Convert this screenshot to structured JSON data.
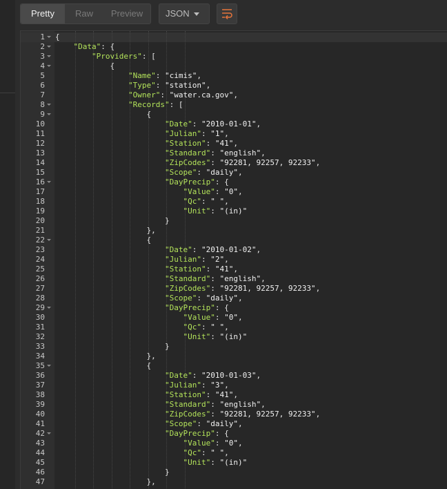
{
  "toolbar": {
    "view_modes": [
      "Pretty",
      "Raw",
      "Preview"
    ],
    "active_mode": "Pretty",
    "format_select": "JSON"
  },
  "editor": {
    "lines": [
      {
        "n": "1",
        "fold": true,
        "indent": 0,
        "parts": [
          [
            "p",
            "{"
          ]
        ]
      },
      {
        "n": "2",
        "fold": true,
        "indent": 1,
        "parts": [
          [
            "k",
            "\"Data\""
          ],
          [
            "p",
            ": {"
          ]
        ]
      },
      {
        "n": "3",
        "fold": true,
        "indent": 2,
        "parts": [
          [
            "k",
            "\"Providers\""
          ],
          [
            "p",
            ": ["
          ]
        ]
      },
      {
        "n": "4",
        "fold": true,
        "indent": 3,
        "parts": [
          [
            "p",
            "{"
          ]
        ]
      },
      {
        "n": "5",
        "fold": false,
        "indent": 4,
        "parts": [
          [
            "k",
            "\"Name\""
          ],
          [
            "p",
            ": "
          ],
          [
            "s",
            "\"cimis\""
          ],
          [
            "p",
            ","
          ]
        ]
      },
      {
        "n": "6",
        "fold": false,
        "indent": 4,
        "parts": [
          [
            "k",
            "\"Type\""
          ],
          [
            "p",
            ": "
          ],
          [
            "s",
            "\"station\""
          ],
          [
            "p",
            ","
          ]
        ]
      },
      {
        "n": "7",
        "fold": false,
        "indent": 4,
        "parts": [
          [
            "k",
            "\"Owner\""
          ],
          [
            "p",
            ": "
          ],
          [
            "s",
            "\"water.ca.gov\""
          ],
          [
            "p",
            ","
          ]
        ]
      },
      {
        "n": "8",
        "fold": true,
        "indent": 4,
        "parts": [
          [
            "k",
            "\"Records\""
          ],
          [
            "p",
            ": ["
          ]
        ]
      },
      {
        "n": "9",
        "fold": true,
        "indent": 5,
        "parts": [
          [
            "p",
            "{"
          ]
        ]
      },
      {
        "n": "10",
        "fold": false,
        "indent": 6,
        "parts": [
          [
            "k",
            "\"Date\""
          ],
          [
            "p",
            ": "
          ],
          [
            "s",
            "\"2010-01-01\""
          ],
          [
            "p",
            ","
          ]
        ]
      },
      {
        "n": "11",
        "fold": false,
        "indent": 6,
        "parts": [
          [
            "k",
            "\"Julian\""
          ],
          [
            "p",
            ": "
          ],
          [
            "s",
            "\"1\""
          ],
          [
            "p",
            ","
          ]
        ]
      },
      {
        "n": "12",
        "fold": false,
        "indent": 6,
        "parts": [
          [
            "k",
            "\"Station\""
          ],
          [
            "p",
            ": "
          ],
          [
            "s",
            "\"41\""
          ],
          [
            "p",
            ","
          ]
        ]
      },
      {
        "n": "13",
        "fold": false,
        "indent": 6,
        "parts": [
          [
            "k",
            "\"Standard\""
          ],
          [
            "p",
            ": "
          ],
          [
            "s",
            "\"english\""
          ],
          [
            "p",
            ","
          ]
        ]
      },
      {
        "n": "14",
        "fold": false,
        "indent": 6,
        "parts": [
          [
            "k",
            "\"ZipCodes\""
          ],
          [
            "p",
            ": "
          ],
          [
            "s",
            "\"92281, 92257, 92233\""
          ],
          [
            "p",
            ","
          ]
        ]
      },
      {
        "n": "15",
        "fold": false,
        "indent": 6,
        "parts": [
          [
            "k",
            "\"Scope\""
          ],
          [
            "p",
            ": "
          ],
          [
            "s",
            "\"daily\""
          ],
          [
            "p",
            ","
          ]
        ]
      },
      {
        "n": "16",
        "fold": true,
        "indent": 6,
        "parts": [
          [
            "k",
            "\"DayPrecip\""
          ],
          [
            "p",
            ": {"
          ]
        ]
      },
      {
        "n": "17",
        "fold": false,
        "indent": 7,
        "parts": [
          [
            "k",
            "\"Value\""
          ],
          [
            "p",
            ": "
          ],
          [
            "s",
            "\"0\""
          ],
          [
            "p",
            ","
          ]
        ]
      },
      {
        "n": "18",
        "fold": false,
        "indent": 7,
        "parts": [
          [
            "k",
            "\"Qc\""
          ],
          [
            "p",
            ": "
          ],
          [
            "s",
            "\" \""
          ],
          [
            "p",
            ","
          ]
        ]
      },
      {
        "n": "19",
        "fold": false,
        "indent": 7,
        "parts": [
          [
            "k",
            "\"Unit\""
          ],
          [
            "p",
            ": "
          ],
          [
            "s",
            "\"(in)\""
          ]
        ]
      },
      {
        "n": "20",
        "fold": false,
        "indent": 6,
        "parts": [
          [
            "p",
            "}"
          ]
        ]
      },
      {
        "n": "21",
        "fold": false,
        "indent": 5,
        "parts": [
          [
            "p",
            "},"
          ]
        ]
      },
      {
        "n": "22",
        "fold": true,
        "indent": 5,
        "parts": [
          [
            "p",
            "{"
          ]
        ]
      },
      {
        "n": "23",
        "fold": false,
        "indent": 6,
        "parts": [
          [
            "k",
            "\"Date\""
          ],
          [
            "p",
            ": "
          ],
          [
            "s",
            "\"2010-01-02\""
          ],
          [
            "p",
            ","
          ]
        ]
      },
      {
        "n": "24",
        "fold": false,
        "indent": 6,
        "parts": [
          [
            "k",
            "\"Julian\""
          ],
          [
            "p",
            ": "
          ],
          [
            "s",
            "\"2\""
          ],
          [
            "p",
            ","
          ]
        ]
      },
      {
        "n": "25",
        "fold": false,
        "indent": 6,
        "parts": [
          [
            "k",
            "\"Station\""
          ],
          [
            "p",
            ": "
          ],
          [
            "s",
            "\"41\""
          ],
          [
            "p",
            ","
          ]
        ]
      },
      {
        "n": "26",
        "fold": false,
        "indent": 6,
        "parts": [
          [
            "k",
            "\"Standard\""
          ],
          [
            "p",
            ": "
          ],
          [
            "s",
            "\"english\""
          ],
          [
            "p",
            ","
          ]
        ]
      },
      {
        "n": "27",
        "fold": false,
        "indent": 6,
        "parts": [
          [
            "k",
            "\"ZipCodes\""
          ],
          [
            "p",
            ": "
          ],
          [
            "s",
            "\"92281, 92257, 92233\""
          ],
          [
            "p",
            ","
          ]
        ]
      },
      {
        "n": "28",
        "fold": false,
        "indent": 6,
        "parts": [
          [
            "k",
            "\"Scope\""
          ],
          [
            "p",
            ": "
          ],
          [
            "s",
            "\"daily\""
          ],
          [
            "p",
            ","
          ]
        ]
      },
      {
        "n": "29",
        "fold": true,
        "indent": 6,
        "parts": [
          [
            "k",
            "\"DayPrecip\""
          ],
          [
            "p",
            ": {"
          ]
        ]
      },
      {
        "n": "30",
        "fold": false,
        "indent": 7,
        "parts": [
          [
            "k",
            "\"Value\""
          ],
          [
            "p",
            ": "
          ],
          [
            "s",
            "\"0\""
          ],
          [
            "p",
            ","
          ]
        ]
      },
      {
        "n": "31",
        "fold": false,
        "indent": 7,
        "parts": [
          [
            "k",
            "\"Qc\""
          ],
          [
            "p",
            ": "
          ],
          [
            "s",
            "\" \""
          ],
          [
            "p",
            ","
          ]
        ]
      },
      {
        "n": "32",
        "fold": false,
        "indent": 7,
        "parts": [
          [
            "k",
            "\"Unit\""
          ],
          [
            "p",
            ": "
          ],
          [
            "s",
            "\"(in)\""
          ]
        ]
      },
      {
        "n": "33",
        "fold": false,
        "indent": 6,
        "parts": [
          [
            "p",
            "}"
          ]
        ]
      },
      {
        "n": "34",
        "fold": false,
        "indent": 5,
        "parts": [
          [
            "p",
            "},"
          ]
        ]
      },
      {
        "n": "35",
        "fold": true,
        "indent": 5,
        "parts": [
          [
            "p",
            "{"
          ]
        ]
      },
      {
        "n": "36",
        "fold": false,
        "indent": 6,
        "parts": [
          [
            "k",
            "\"Date\""
          ],
          [
            "p",
            ": "
          ],
          [
            "s",
            "\"2010-01-03\""
          ],
          [
            "p",
            ","
          ]
        ]
      },
      {
        "n": "37",
        "fold": false,
        "indent": 6,
        "parts": [
          [
            "k",
            "\"Julian\""
          ],
          [
            "p",
            ": "
          ],
          [
            "s",
            "\"3\""
          ],
          [
            "p",
            ","
          ]
        ]
      },
      {
        "n": "38",
        "fold": false,
        "indent": 6,
        "parts": [
          [
            "k",
            "\"Station\""
          ],
          [
            "p",
            ": "
          ],
          [
            "s",
            "\"41\""
          ],
          [
            "p",
            ","
          ]
        ]
      },
      {
        "n": "39",
        "fold": false,
        "indent": 6,
        "parts": [
          [
            "k",
            "\"Standard\""
          ],
          [
            "p",
            ": "
          ],
          [
            "s",
            "\"english\""
          ],
          [
            "p",
            ","
          ]
        ]
      },
      {
        "n": "40",
        "fold": false,
        "indent": 6,
        "parts": [
          [
            "k",
            "\"ZipCodes\""
          ],
          [
            "p",
            ": "
          ],
          [
            "s",
            "\"92281, 92257, 92233\""
          ],
          [
            "p",
            ","
          ]
        ]
      },
      {
        "n": "41",
        "fold": false,
        "indent": 6,
        "parts": [
          [
            "k",
            "\"Scope\""
          ],
          [
            "p",
            ": "
          ],
          [
            "s",
            "\"daily\""
          ],
          [
            "p",
            ","
          ]
        ]
      },
      {
        "n": "42",
        "fold": true,
        "indent": 6,
        "parts": [
          [
            "k",
            "\"DayPrecip\""
          ],
          [
            "p",
            ": {"
          ]
        ]
      },
      {
        "n": "43",
        "fold": false,
        "indent": 7,
        "parts": [
          [
            "k",
            "\"Value\""
          ],
          [
            "p",
            ": "
          ],
          [
            "s",
            "\"0\""
          ],
          [
            "p",
            ","
          ]
        ]
      },
      {
        "n": "44",
        "fold": false,
        "indent": 7,
        "parts": [
          [
            "k",
            "\"Qc\""
          ],
          [
            "p",
            ": "
          ],
          [
            "s",
            "\" \""
          ],
          [
            "p",
            ","
          ]
        ]
      },
      {
        "n": "45",
        "fold": false,
        "indent": 7,
        "parts": [
          [
            "k",
            "\"Unit\""
          ],
          [
            "p",
            ": "
          ],
          [
            "s",
            "\"(in)\""
          ]
        ]
      },
      {
        "n": "46",
        "fold": false,
        "indent": 6,
        "parts": [
          [
            "p",
            "}"
          ]
        ]
      },
      {
        "n": "47",
        "fold": false,
        "indent": 5,
        "parts": [
          [
            "p",
            "},"
          ]
        ]
      }
    ]
  },
  "colors": {
    "key": "#b3e35a",
    "wrap_icon": "#e8743b"
  },
  "icons": {
    "wrap": "wrap-lines-icon",
    "dropdown": "chevron-down-icon"
  }
}
